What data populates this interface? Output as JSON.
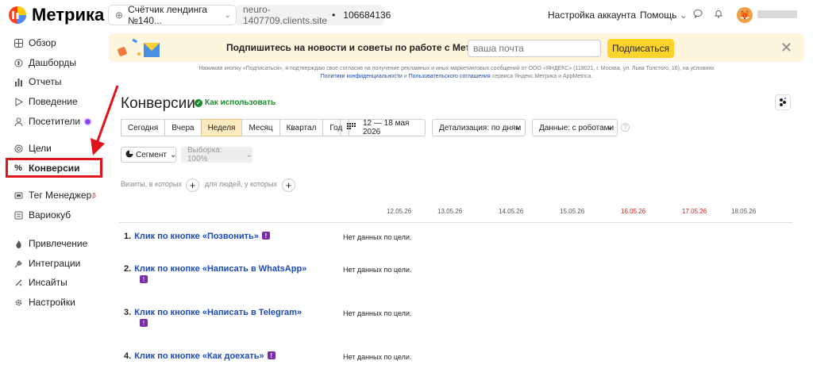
{
  "header": {
    "logo_text": "Метрика",
    "counter_name": "Счётчик лендинга №140...",
    "site_domain": "neuro-1407709.clients.site",
    "site_separator": "•",
    "counter_id": "106684136",
    "account_settings": "Настройка аккаунта",
    "help": "Помощь"
  },
  "sidebar": {
    "items": [
      {
        "label": "Обзор",
        "icon": "grid-icon"
      },
      {
        "label": "Дашборды",
        "icon": "dashboard-icon"
      },
      {
        "label": "Отчеты",
        "icon": "bar-chart-icon"
      },
      {
        "label": "Поведение",
        "icon": "play-icon"
      },
      {
        "label": "Посетители",
        "icon": "user-icon"
      },
      {
        "label": "Цели",
        "icon": "target-icon"
      },
      {
        "label": "Конверсии",
        "icon": "percent-icon"
      },
      {
        "label": "Тег Менеджер",
        "icon": "tag-icon",
        "sup": "β"
      },
      {
        "label": "Вариокуб",
        "icon": "cube-icon"
      },
      {
        "label": "Привлечение",
        "icon": "fire-icon"
      },
      {
        "label": "Интеграции",
        "icon": "plug-icon"
      },
      {
        "label": "Инсайты",
        "icon": "sparkle-icon"
      },
      {
        "label": "Настройки",
        "icon": "gear-icon"
      }
    ]
  },
  "banner": {
    "text": "Подпишитесь на новости и советы по работе с Метрикой",
    "email_placeholder": "ваша почта",
    "subscribe": "Подписаться",
    "legal_line1": "Нажимая кнопку «Подписаться», я подтверждаю свое согласие на получение рекламных и иных маркетинговых сообщений от ООО «ЯНДЕКС» (119021, г. Москва, ул. Льва Толстого, 16), на условиях",
    "legal_link1": "Политики конфиденциальности",
    "legal_and": " и ",
    "legal_link2": "Пользовательского соглашения",
    "legal_tail": " сервиса Яндекс.Метрика и AppMetrica."
  },
  "page": {
    "title": "Конверсии",
    "howto": "Как использовать"
  },
  "toolbar": {
    "periods": [
      "Сегодня",
      "Вчера",
      "Неделя",
      "Месяц",
      "Квартал",
      "Год"
    ],
    "selected_period": "Неделя",
    "date_range": "12 — 18 мая 2026",
    "detail": "Детализация: по дням",
    "data": "Данные: с роботами",
    "segment": "Сегмент",
    "sample": "Выборка: 100%"
  },
  "filters": {
    "visits_label": "Визиты, в которых",
    "people_label": "для людей, у которых"
  },
  "timeline": {
    "dates": [
      {
        "label": "12.05.26",
        "weekend": false
      },
      {
        "label": "13.05.26",
        "weekend": false
      },
      {
        "label": "14.05.26",
        "weekend": false
      },
      {
        "label": "15.05.26",
        "weekend": false
      },
      {
        "label": "16.05.26",
        "weekend": true
      },
      {
        "label": "17.05.26",
        "weekend": true
      },
      {
        "label": "18.05.26",
        "weekend": false
      }
    ]
  },
  "goals": [
    {
      "num": "1.",
      "name": "Клик по кнопке «Позвонить»",
      "status": "Нет данных по цели."
    },
    {
      "num": "2.",
      "name": "Клик по кнопке «Написать в WhatsApp»",
      "status": "Нет данных по цели."
    },
    {
      "num": "3.",
      "name": "Клик по кнопке «Написать в Telegram»",
      "status": "Нет данных по цели."
    },
    {
      "num": "4.",
      "name": "Клик по кнопке «Как доехать»",
      "status": "Нет данных по цели."
    }
  ],
  "colors": {
    "accent_yellow": "#fed42b",
    "link_blue": "#1a4ab6",
    "highlight_red": "#e0141b",
    "goal_badge": "#7a2ea8",
    "weekend_red": "#d12020"
  }
}
